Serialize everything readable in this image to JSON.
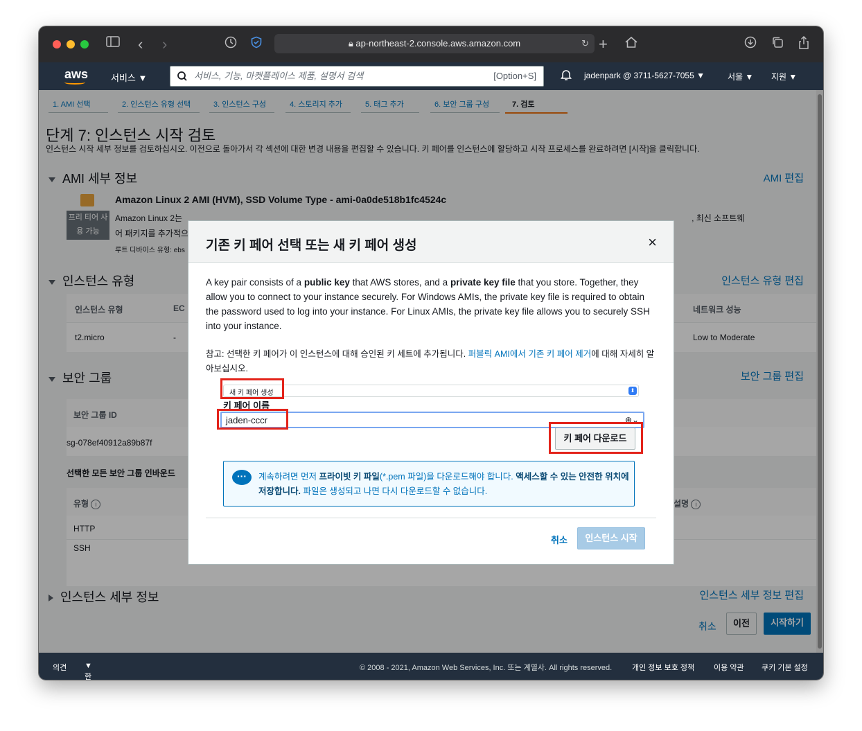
{
  "browser": {
    "url": "ap-northeast-2.console.aws.amazon.com"
  },
  "aws_nav": {
    "services_label": "서비스",
    "search_placeholder": "서비스, 기능, 마켓플레이스 제품, 설명서 검색",
    "search_shortcut": "[Option+S]",
    "account": "jadenpark @ 3711-5627-7055",
    "region": "서울",
    "support": "지원"
  },
  "steps": [
    {
      "label": "1. AMI 선택"
    },
    {
      "label": "2. 인스턴스 유형 선택"
    },
    {
      "label": "3. 인스턴스 구성"
    },
    {
      "label": "4. 스토리지 추가"
    },
    {
      "label": "5. 태그 추가"
    },
    {
      "label": "6. 보안 그룹 구성"
    },
    {
      "label": "7. 검토"
    }
  ],
  "page": {
    "title": "단계 7: 인스턴스 시작 검토",
    "description": "인스턴스 시작 세부 정보를 검토하십시오. 이전으로 돌아가서 각 섹션에 대한 변경 내용을 편집할 수 있습니다. 키 페어를 인스턴스에 할당하고 시작 프로세스를 완료하려면 [시작]을 클릭합니다."
  },
  "ami": {
    "section_title": "AMI 세부 정보",
    "edit_label": "AMI 편집",
    "name": "Amazon Linux 2 AMI (HVM), SSD Volume Type - ami-0a0de518b1fc4524c",
    "free_tier_badge_line1": "프리 티어 사",
    "free_tier_badge_line2": "용 가능",
    "desc_line1_prefix": "Amazon Linux 2는",
    "desc_line1_suffix": ", 최신 소프트웨",
    "desc_line2": "어 패키지를 추가적으",
    "root_device": "루트 디바이스 유형: ebs"
  },
  "instance_type": {
    "section_title": "인스턴스 유형",
    "edit_label": "인스턴스 유형 편집",
    "col_type": "인스턴스 유형",
    "col_ecu": "EC",
    "col_network": "네트워크 성능",
    "val_type": "t2.micro",
    "val_ecu": "-",
    "val_network": "Low to Moderate"
  },
  "security_group": {
    "section_title": "보안 그룹",
    "edit_label": "보안 그룹 편집",
    "col_id": "보안 그룹 ID",
    "val_id": "sg-078ef40912a89b87f",
    "inbound_title": "선택한 모든 보안 그룹 인바운드",
    "col_type": "유형",
    "col_desc": "설명",
    "rule1": "HTTP",
    "rule2": "SSH"
  },
  "instance_details": {
    "section_title": "인스턴스 세부 정보",
    "edit_label": "인스턴스 세부 정보 편집"
  },
  "bottom_actions": {
    "cancel": "취소",
    "previous": "이전",
    "launch": "시작하기"
  },
  "modal": {
    "title": "기존 키 페어 선택 또는 새 키 페어 생성",
    "close": "×",
    "para_part1": "A key pair consists of a ",
    "para_bold1": "public key",
    "para_part2": " that AWS stores, and a ",
    "para_bold2": "private key file",
    "para_part3": " that you store. Together, they allow you to connect to your instance securely. For Windows AMIs, the private key file is required to obtain the password used to log into your instance. For Linux AMIs, the private key file allows you to securely SSH into your instance.",
    "note_prefix": "참고: 선택한 키 페어가 이 인스턴스에 대해 승인된 키 세트에 추가됩니다. ",
    "note_link": "퍼블릭 AMI에서 기존 키 페어 제거",
    "note_suffix": "에 대해 자세히 알아보십시오.",
    "select_value": "새 키 페어 생성",
    "keypair_name_label": "키 페어 이름",
    "keypair_name_value": "jaden-cccr",
    "download_button": "키 페어 다운로드",
    "info_part1": "계속하려면 먼저 ",
    "info_bold1": "프라이빗 키 파일",
    "info_part2": "(*.pem 파일)을 다운로드해야 합니다. ",
    "info_bold2": "액세스할 수 있는 안전한 위치에 저장합니다.",
    "info_part3": " 파일은 생성되고 나면 다시 다운로드할 수 없습니다.",
    "cancel": "취소",
    "launch": "인스턴스 시작"
  },
  "footer": {
    "feedback": "의견",
    "language": "한국어",
    "copyright": "© 2008 - 2021, Amazon Web Services, Inc. 또는 계열사. All rights reserved.",
    "privacy": "개인 정보 보호 정책",
    "terms": "이용 약관",
    "cookies": "쿠키 기본 설정"
  }
}
